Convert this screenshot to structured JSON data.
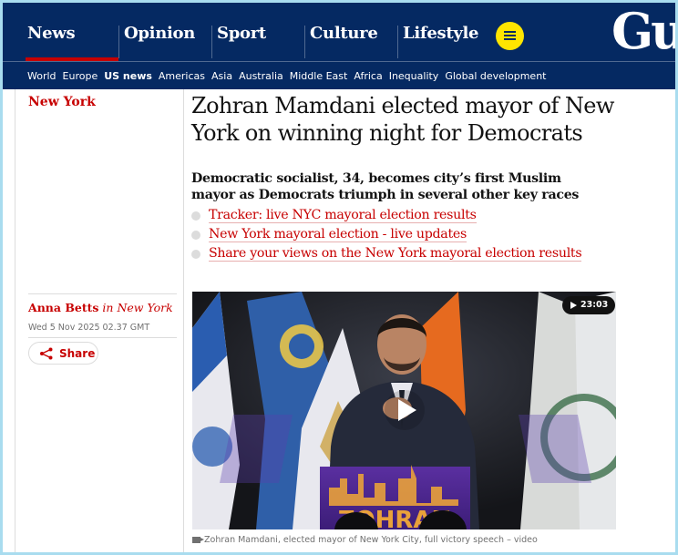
{
  "nav": {
    "pillars": [
      {
        "label": "News",
        "active": true
      },
      {
        "label": "Opinion",
        "active": false
      },
      {
        "label": "Sport",
        "active": false
      },
      {
        "label": "Culture",
        "active": false
      },
      {
        "label": "Lifestyle",
        "active": false
      }
    ],
    "logo_text": "Gu",
    "subnav": [
      {
        "label": "World",
        "active": false
      },
      {
        "label": "Europe",
        "active": false
      },
      {
        "label": "US news",
        "active": true
      },
      {
        "label": "Americas",
        "active": false
      },
      {
        "label": "Asia",
        "active": false
      },
      {
        "label": "Australia",
        "active": false
      },
      {
        "label": "Middle East",
        "active": false
      },
      {
        "label": "Africa",
        "active": false
      },
      {
        "label": "Inequality",
        "active": false
      },
      {
        "label": "Global development",
        "active": false
      }
    ]
  },
  "article": {
    "section": "New York",
    "headline": "Zohran Mamdani elected mayor of New York on winning night for Democrats",
    "standfirst": "Democratic socialist, 34, becomes city’s first Muslim mayor as Democrats triumph in several other key races",
    "links": [
      "Tracker: live NYC mayoral election results",
      "New York mayoral election - live updates",
      "Share your views on the New York mayoral election results"
    ],
    "author": "Anna Betts",
    "author_location": "in New York",
    "date": "Wed 5 Nov 2025 02.37 GMT",
    "share_label": "Share",
    "video_duration": "23:03",
    "caption": "Zohran Mamdani, elected mayor of New York City, full victory speech – video",
    "podium_sign_text": "ZOHRAN"
  },
  "colors": {
    "brand_navy": "#052962",
    "accent_red": "#c70000",
    "menu_yellow": "#ffe500",
    "frame": "#a9dcef"
  }
}
